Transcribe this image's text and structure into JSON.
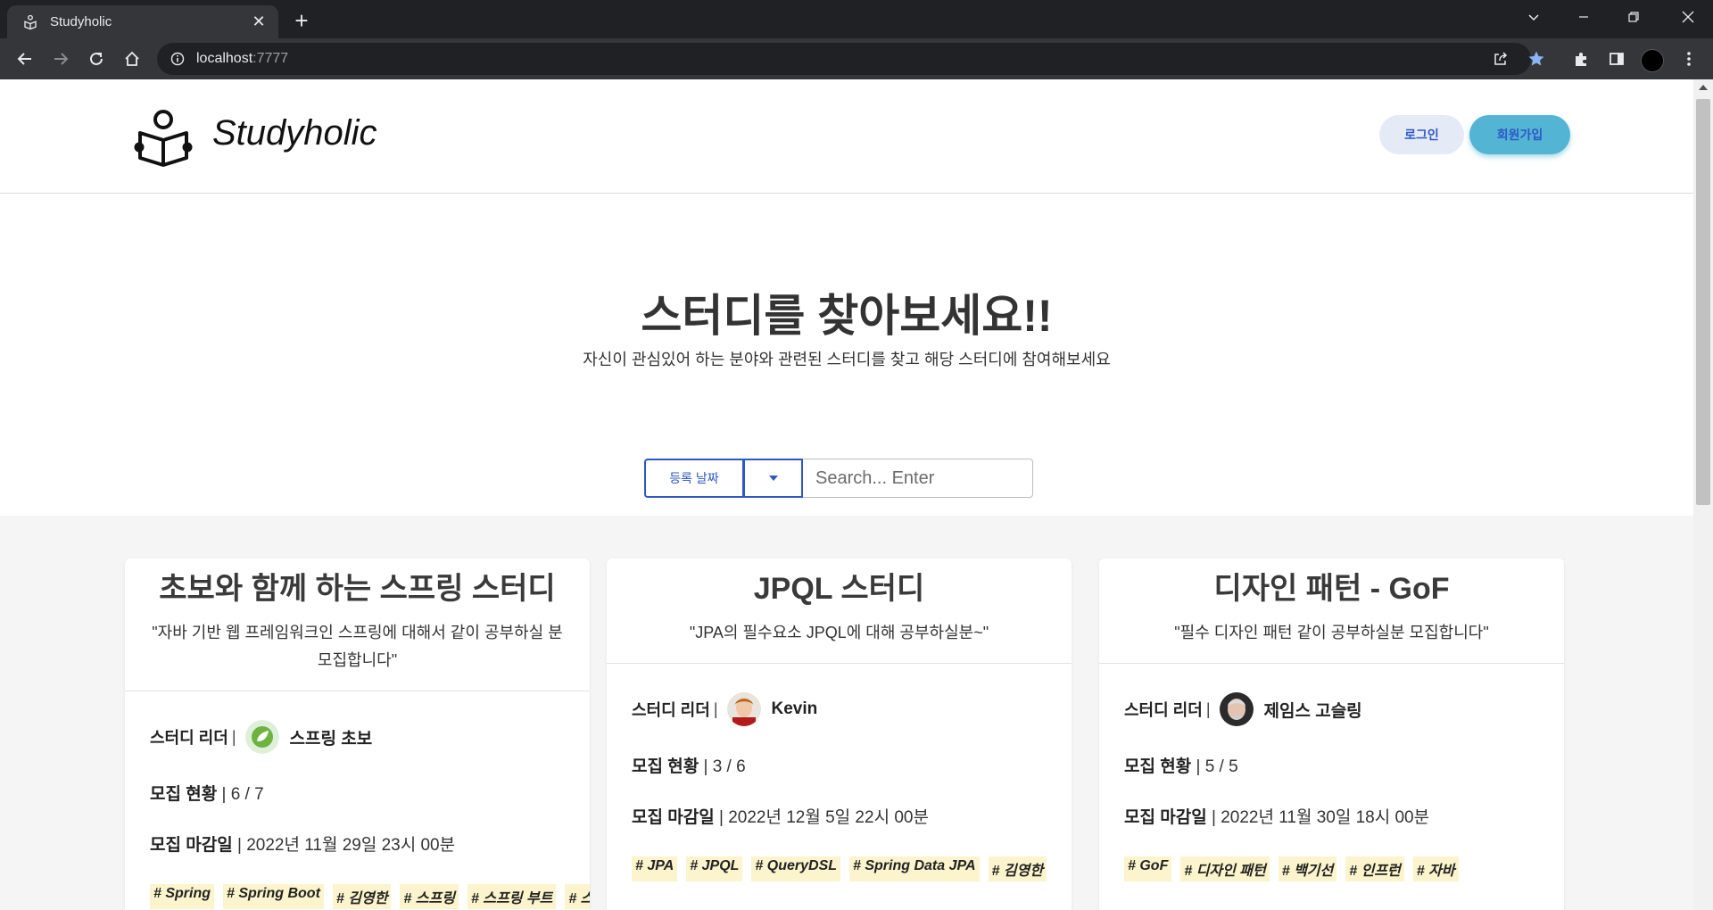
{
  "browser": {
    "tab_title": "Studyholic",
    "url_host": "localhost",
    "url_port": ":7777"
  },
  "header": {
    "logo_text": "Studyholic",
    "login_label": "로그인",
    "signup_label": "회원가입"
  },
  "hero": {
    "title": "스터디를 찾아보세요!!",
    "subtitle": "자신이 관심있어 하는 분야와 관련된 스터디를 찾고 해당 스터디에 참여해보세요"
  },
  "search": {
    "sort_label": "등록 날짜",
    "placeholder": "Search... Enter"
  },
  "labels": {
    "leader": "스터디 리더",
    "status": "모집 현황",
    "deadline": "모집 마감일",
    "separator": "|"
  },
  "cards": [
    {
      "title": "초보와 함께 하는 스프링 스터디",
      "description": "\"자바 기반 웹 프레임워크인 스프링에 대해서 같이 공부하실 분 모집합니다\"",
      "leader": "스프링 초보",
      "status": "6 / 7",
      "deadline": "2022년 11월 29일 23시 00분",
      "tags": [
        "# Spring",
        "# Spring Boot",
        "# 김영한",
        "# 스프링",
        "# 스프링 부트",
        "# 스"
      ]
    },
    {
      "title": "JPQL 스터디",
      "description": "\"JPA의 필수요소 JPQL에 대해 공부하실분~\"",
      "leader": "Kevin",
      "status": "3 / 6",
      "deadline": "2022년 12월 5일 22시 00분",
      "tags": [
        "# JPA",
        "# JPQL",
        "# QueryDSL",
        "# Spring Data JPA",
        "# 김영한"
      ]
    },
    {
      "title": "디자인 패턴 - GoF",
      "description": "\"필수 디자인 패턴 같이 공부하실분 모집합니다\"",
      "leader": "제임스 고슬링",
      "status": "5 / 5",
      "deadline": "2022년 11월 30일 18시 00분",
      "tags": [
        "# GoF",
        "# 디자인 패턴",
        "# 백기선",
        "# 인프런",
        "# 자바"
      ]
    }
  ],
  "colors": {
    "accent": "#2d58c6",
    "signup_bg": "#54b4d3",
    "tag_bg": "#fbf4cc"
  }
}
